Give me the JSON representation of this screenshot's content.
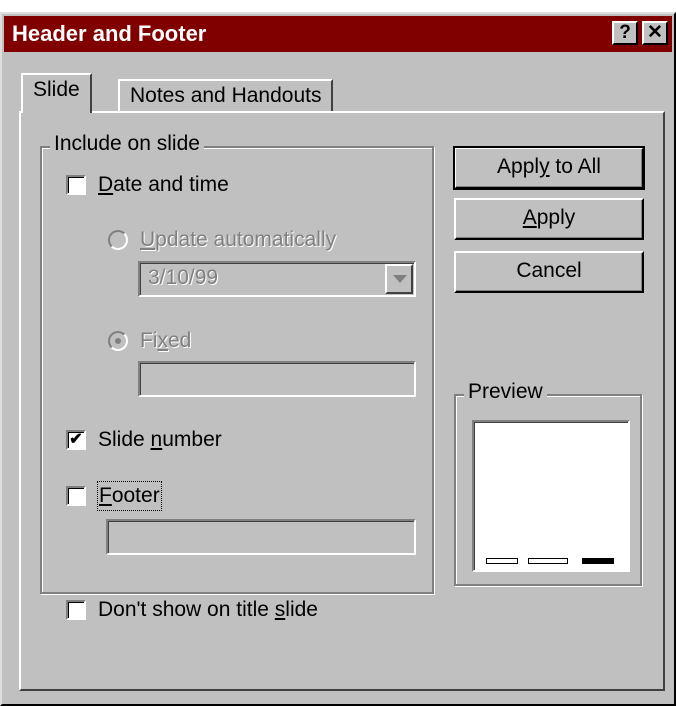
{
  "window": {
    "title": "Header and Footer",
    "help_label": "?",
    "close_label": "✕"
  },
  "tabs": [
    {
      "label": "Slide",
      "selected": true
    },
    {
      "label": "Notes and Handouts",
      "selected": false
    }
  ],
  "include_group": {
    "legend": "Include on slide",
    "date_time": {
      "label_accel": "D",
      "label_rest": "ate and time",
      "checked": false
    },
    "update_auto": {
      "label_accel": "U",
      "label_rest": "pdate automatically",
      "selected": false,
      "enabled": false
    },
    "date_value": "3/10/99",
    "fixed": {
      "label_pre": "Fi",
      "label_accel": "x",
      "label_post": "ed",
      "selected": true,
      "enabled": false
    },
    "fixed_value": "",
    "slide_number": {
      "label_pre": "Slide ",
      "label_accel": "n",
      "label_post": "umber",
      "checked": true
    },
    "footer": {
      "label_accel": "F",
      "label_rest": "ooter",
      "checked": false
    },
    "footer_value": ""
  },
  "dont_show": {
    "label_pre": "Don't show on title ",
    "label_accel": "s",
    "label_post": "lide",
    "checked": false
  },
  "buttons": {
    "apply_all": {
      "pre": "Appl",
      "accel": "y",
      "post": " to All"
    },
    "apply": {
      "pre": "",
      "accel": "A",
      "post": "pply"
    },
    "cancel": "Cancel"
  },
  "preview": {
    "legend": "Preview"
  },
  "check_mark": "✔"
}
